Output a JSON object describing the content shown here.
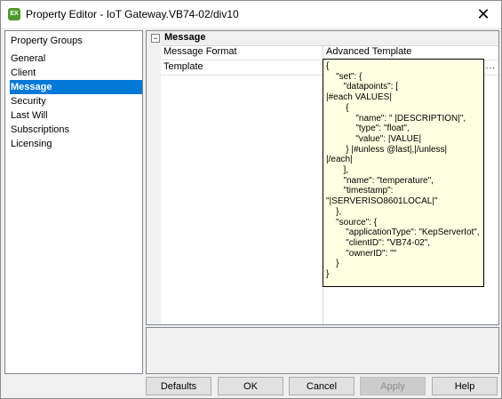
{
  "window": {
    "title": "Property Editor - IoT Gateway.VB74-02/div10",
    "icon_text": "EX",
    "close_glyph": "✕"
  },
  "groups": {
    "header": "Property Groups",
    "items": [
      {
        "label": "General"
      },
      {
        "label": "Client"
      },
      {
        "label": "Message",
        "selected": true
      },
      {
        "label": "Security"
      },
      {
        "label": "Last Will"
      },
      {
        "label": "Subscriptions"
      },
      {
        "label": "Licensing"
      }
    ]
  },
  "grid": {
    "category": "Message",
    "collapse_glyph": "−",
    "rows": [
      {
        "name": "Message Format",
        "value": "Advanced Template"
      },
      {
        "name": "Template",
        "value": "",
        "button": "..."
      }
    ]
  },
  "template_editor": {
    "text": "{\n    \"set\": {\n       \"datapoints\": [\n|#each VALUES|\n        {\n            \"name\": \" |DESCRIPTION|\",\n            \"type\": \"float\",\n            \"value\": |VALUE|\n        } |#unless @last|,|/unless|\n|/each|\n       ],\n       \"name\": \"temperature\",\n       \"timestamp\":\n\"|SERVERISO8601LOCAL|\"\n    },\n    \"source\": {\n        \"applicationType\": \"KepServerIot\",\n        \"clientID\": \"VB74-02\",\n        \"ownerID\": \"\"\n    }\n}"
  },
  "buttons": {
    "defaults": "Defaults",
    "ok": "OK",
    "cancel": "Cancel",
    "apply": "Apply",
    "help": "Help"
  },
  "colors": {
    "selection": "#0078d7",
    "tooltip_bg": "#ffffe1",
    "app_icon": "#4f9a2e"
  }
}
